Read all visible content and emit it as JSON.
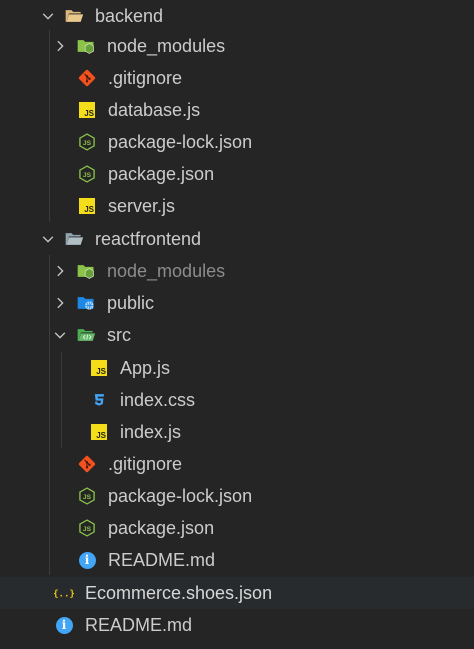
{
  "explorer": {
    "rows": [
      {
        "label": "backend",
        "type": "folder-open",
        "chevron": "down",
        "depth": 0
      },
      {
        "label": "node_modules",
        "type": "node-folder",
        "chevron": "right",
        "depth": 1
      },
      {
        "label": ".gitignore",
        "type": "git",
        "depth": 1
      },
      {
        "label": "database.js",
        "type": "js",
        "depth": 1
      },
      {
        "label": "package-lock.json",
        "type": "node-json",
        "depth": 1
      },
      {
        "label": "package.json",
        "type": "node-json",
        "depth": 1
      },
      {
        "label": "server.js",
        "type": "js",
        "depth": 1
      },
      {
        "label": "reactfrontend",
        "type": "folder-open-plain",
        "chevron": "down",
        "depth": 0
      },
      {
        "label": "node_modules",
        "type": "node-folder",
        "chevron": "right",
        "depth": 1,
        "dim": true
      },
      {
        "label": "public",
        "type": "public-folder",
        "chevron": "right",
        "depth": 1
      },
      {
        "label": "src",
        "type": "src-folder",
        "chevron": "down",
        "depth": 1
      },
      {
        "label": "App.js",
        "type": "js",
        "depth": 2
      },
      {
        "label": "index.css",
        "type": "css",
        "depth": 2
      },
      {
        "label": "index.js",
        "type": "js",
        "depth": 2
      },
      {
        "label": ".gitignore",
        "type": "git",
        "depth": 1
      },
      {
        "label": "package-lock.json",
        "type": "node-json",
        "depth": 1
      },
      {
        "label": "package.json",
        "type": "node-json",
        "depth": 1
      },
      {
        "label": "README.md",
        "type": "info",
        "depth": 1
      },
      {
        "label": "Ecommerce.shoes.json",
        "type": "json",
        "depth": 0,
        "selected": true
      },
      {
        "label": "README.md",
        "type": "info",
        "depth": 0
      }
    ]
  },
  "colors": {
    "background": "#252526",
    "text": "#cccccc",
    "dim_text": "#8c8c8c",
    "folder": "#dcb67a",
    "node_green": "#8bc34a",
    "git_orange": "#f4511e",
    "js_yellow": "#f5de19",
    "css_blue": "#42a5f5",
    "public_blue": "#1e88e5",
    "info_blue": "#42a5f5",
    "json_yellow": "#f1c40f"
  },
  "icons": {
    "folder-open": "folder-open-icon",
    "folder-open-plain": "folder-open-icon",
    "node-folder": "node-folder-icon",
    "git": "git-icon",
    "js": "javascript-file-icon",
    "node-json": "nodejs-icon",
    "public-folder": "public-folder-icon",
    "src-folder": "src-folder-icon",
    "css": "css-file-icon",
    "info": "info-icon",
    "json": "json-file-icon"
  }
}
